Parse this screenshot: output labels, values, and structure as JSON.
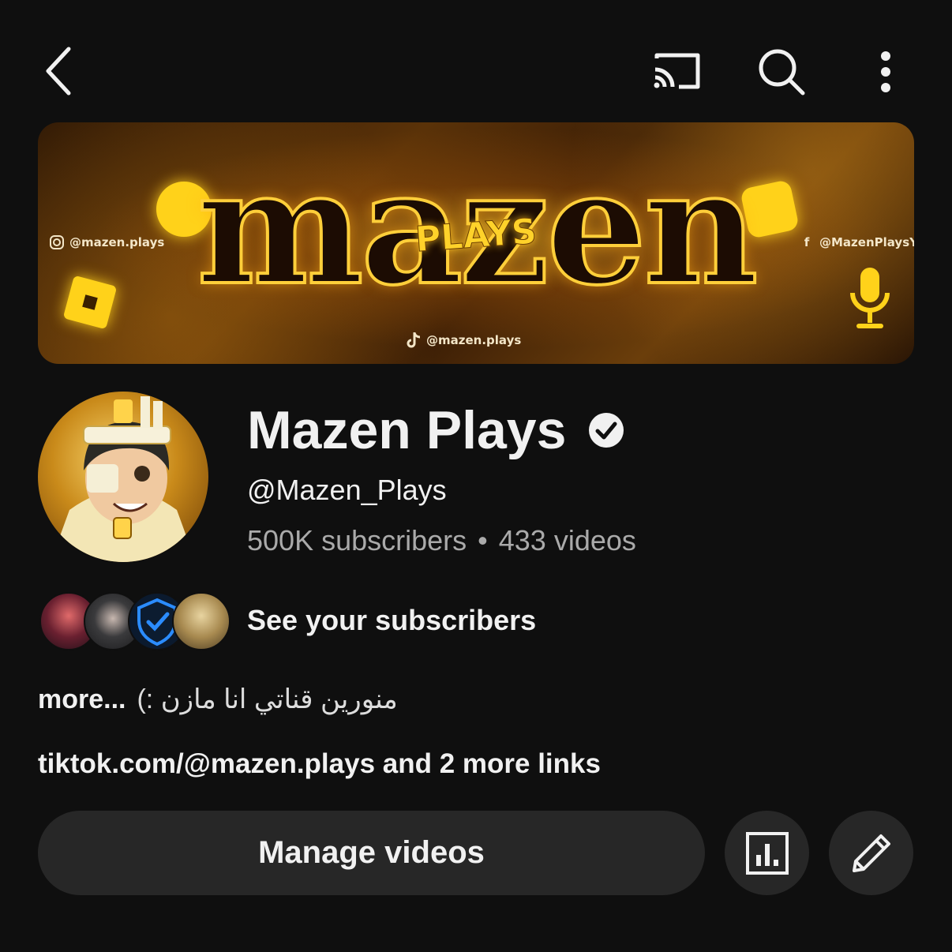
{
  "topbar": {
    "back_icon": "chevron-left-icon",
    "cast_icon": "cast-icon",
    "search_icon": "search-icon",
    "menu_icon": "more-vert-icon"
  },
  "banner": {
    "title": "mazen",
    "subtitle": "PLAYS",
    "instagram": "@mazen.plays",
    "facebook": "@MazenPlaysYT",
    "tiktok": "@mazen.plays",
    "accent_color": "#ffd21a"
  },
  "channel": {
    "name": "Mazen Plays",
    "handle": "@Mazen_Plays",
    "subscribers": "500K subscribers",
    "separator": "•",
    "videos": "433 videos"
  },
  "subscribers_row": {
    "label": "See your subscribers"
  },
  "description": {
    "text": "منورين قناتي انا مازن :)",
    "more": "more..."
  },
  "links": {
    "text": "tiktok.com/@mazen.plays and 2 more links"
  },
  "actions": {
    "manage_label": "Manage videos",
    "analytics_icon": "analytics-icon",
    "edit_icon": "pencil-icon"
  }
}
